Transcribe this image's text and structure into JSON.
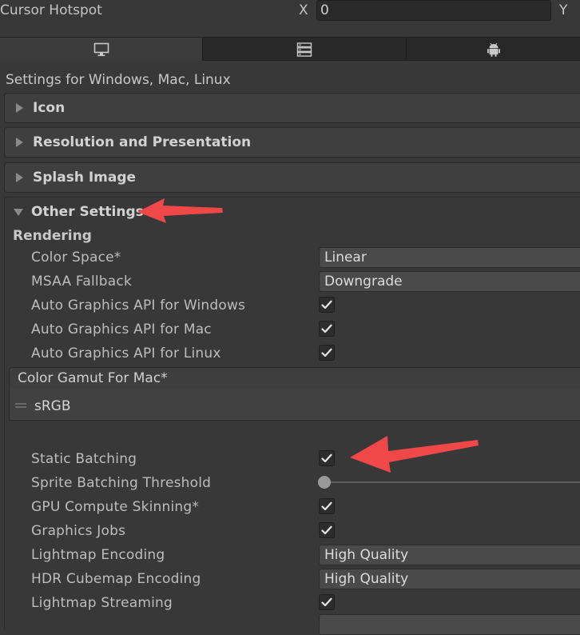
{
  "top": {
    "cursor_hotspot_label": "Cursor Hotspot",
    "x_label": "X",
    "x_value": "0",
    "y_label": "Y"
  },
  "tabs": [
    {
      "icon": "monitor-icon",
      "active": true
    },
    {
      "icon": "server-icon",
      "active": false
    },
    {
      "icon": "android-icon",
      "active": false
    }
  ],
  "settings_title": "Settings for Windows, Mac, Linux",
  "foldouts": {
    "icon": "Icon",
    "resolution": "Resolution and Presentation",
    "splash": "Splash Image",
    "other": "Other Settings"
  },
  "rendering": {
    "header": "Rendering",
    "color_space_label": "Color Space*",
    "color_space_value": "Linear",
    "msaa_label": "MSAA Fallback",
    "msaa_value": "Downgrade",
    "auto_win_label": "Auto Graphics API  for Windows",
    "auto_mac_label": "Auto Graphics API  for Mac",
    "auto_linux_label": "Auto Graphics API  for Linux",
    "gamut_header": "Color Gamut For Mac*",
    "gamut_item": "sRGB",
    "static_batching_label": "Static Batching",
    "sprite_threshold_label": "Sprite Batching Threshold",
    "sprite_threshold_fraction": 0,
    "gpu_skinning_label": "GPU Compute Skinning*",
    "graphics_jobs_label": "Graphics Jobs",
    "lightmap_encoding_label": "Lightmap Encoding",
    "lightmap_encoding_value": "High Quality",
    "hdr_cubemap_label": "HDR Cubemap Encoding",
    "hdr_cubemap_value": "High Quality",
    "lightmap_streaming_label": "Lightmap Streaming"
  },
  "checked": {
    "auto_win": true,
    "auto_mac": true,
    "auto_linux": true,
    "static_batching": true,
    "gpu_skinning": true,
    "graphics_jobs": true,
    "lightmap_streaming": true
  },
  "colors": {
    "annotation_arrow": "#f04848",
    "background": "#383838"
  }
}
